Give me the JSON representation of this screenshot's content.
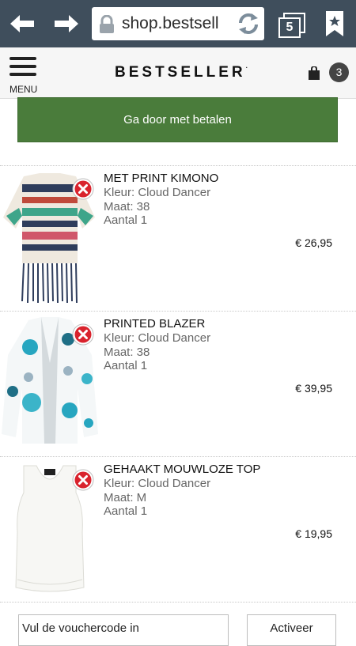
{
  "browser": {
    "url": "shop.bestsell",
    "tab_count": "5"
  },
  "header": {
    "menu_label": "MENU",
    "logo": "BESTSELLER",
    "logo_mark": "·",
    "cart_count": "3"
  },
  "checkout": {
    "label": "Ga door met betalen"
  },
  "items": [
    {
      "title": "MET PRINT KIMONO",
      "color": "Kleur: Cloud Dancer",
      "size": "Maat: 38",
      "quantity": "Aantal 1",
      "price": "€ 26,95"
    },
    {
      "title": "PRINTED BLAZER",
      "color": "Kleur: Cloud Dancer",
      "size": "Maat: 38",
      "quantity": "Aantal 1",
      "price": "€ 39,95"
    },
    {
      "title": "GEHAAKT MOUWLOZE TOP",
      "color": "Kleur: Cloud Dancer",
      "size": "Maat: M",
      "quantity": "Aantal 1",
      "price": "€ 19,95"
    }
  ],
  "voucher": {
    "placeholder": "Vul de vouchercode in",
    "button_label": "Activeer"
  },
  "colors": {
    "browser_bar": "#3f4e5c",
    "checkout_green": "#4a7c3b",
    "remove_red": "#d9232d"
  }
}
